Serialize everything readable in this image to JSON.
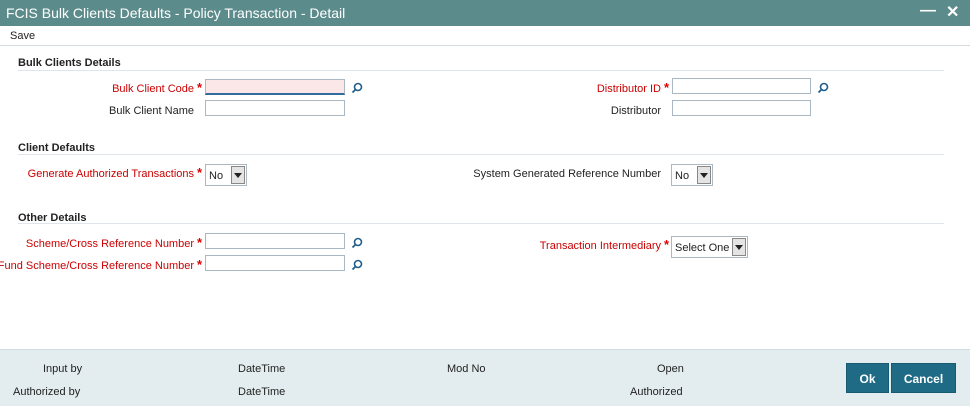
{
  "window": {
    "title": "FCIS Bulk Clients Defaults - Policy Transaction - Detail",
    "minimize_icon": "minimize-icon",
    "close_icon": "close-icon"
  },
  "menu": {
    "save_label": "Save"
  },
  "sections": {
    "bulk_clients_details": {
      "heading": "Bulk Clients Details",
      "bulk_client_code": {
        "label": "Bulk Client Code",
        "required": true,
        "value": ""
      },
      "bulk_client_name": {
        "label": "Bulk Client Name",
        "value": ""
      },
      "distributor_id": {
        "label": "Distributor ID",
        "required": true,
        "value": ""
      },
      "distributor": {
        "label": "Distributor",
        "value": ""
      }
    },
    "client_defaults": {
      "heading": "Client Defaults",
      "generate_authorized_transactions": {
        "label": "Generate Authorized Transactions",
        "required": true,
        "value": "No"
      },
      "system_generated_reference_number": {
        "label": "System Generated Reference Number",
        "value": "No"
      }
    },
    "other_details": {
      "heading": "Other Details",
      "scheme_cross_reference_number": {
        "label": "Scheme/Cross Reference Number",
        "required": true,
        "value": ""
      },
      "fund_scheme_cross_reference_number": {
        "label": "Fund Scheme/Cross Reference Number",
        "required": true,
        "value": ""
      },
      "transaction_intermediary": {
        "label": "Transaction Intermediary",
        "required": true,
        "value": "Select One"
      }
    }
  },
  "required_marker": "*",
  "footer": {
    "input_by": "Input by",
    "datetime_1": "DateTime",
    "mod_no": "Mod No",
    "open": "Open",
    "authorized_by": "Authorized by",
    "datetime_2": "DateTime",
    "authorized": "Authorized",
    "ok_label": "Ok",
    "cancel_label": "Cancel"
  },
  "colors": {
    "titlebar": "#5c8b8b",
    "required_label": "#cc0000",
    "button": "#1f6b86",
    "footer_bg": "#e3edf0"
  }
}
